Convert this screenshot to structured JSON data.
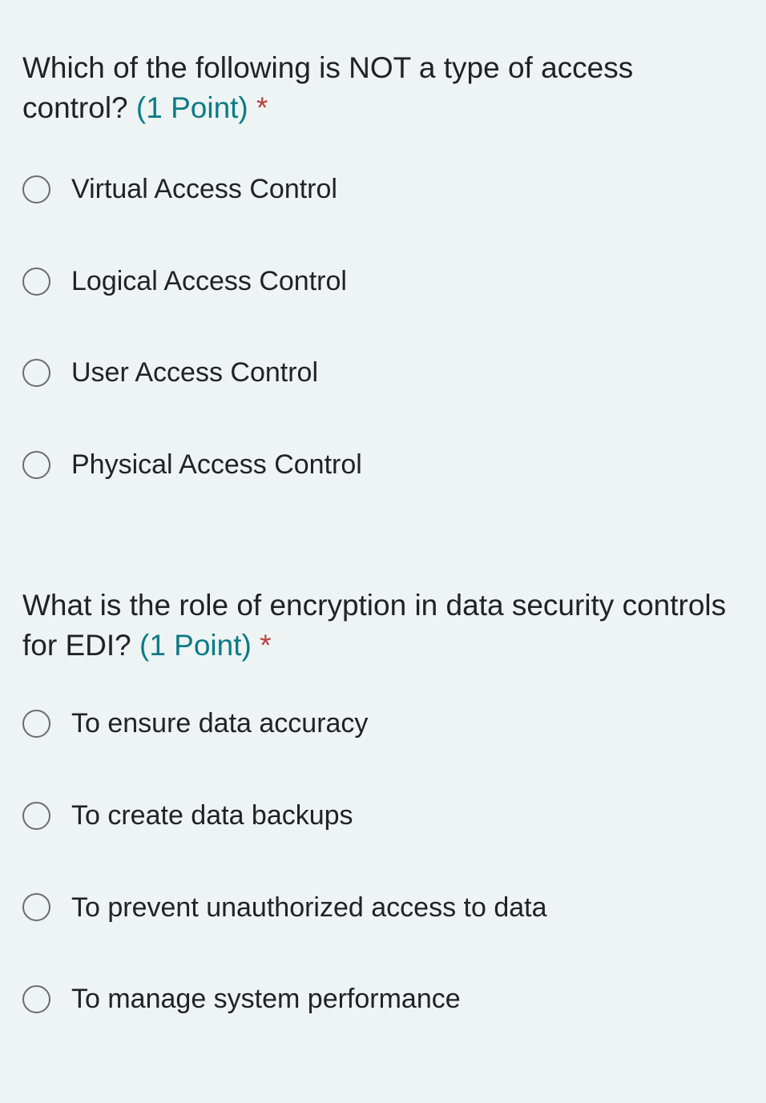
{
  "questions": [
    {
      "text": "Which of the following is NOT a type of access control?",
      "points": "(1 Point)",
      "required": "*",
      "options": [
        "Virtual Access Control",
        "Logical Access Control",
        "User Access Control",
        "Physical Access Control"
      ]
    },
    {
      "text": "What is the role of encryption in data security controls for EDI?",
      "points": "(1 Point)",
      "required": "*",
      "options": [
        "To ensure data accuracy",
        "To create data backups",
        "To prevent unauthorized access to data",
        "To manage system performance"
      ]
    }
  ]
}
